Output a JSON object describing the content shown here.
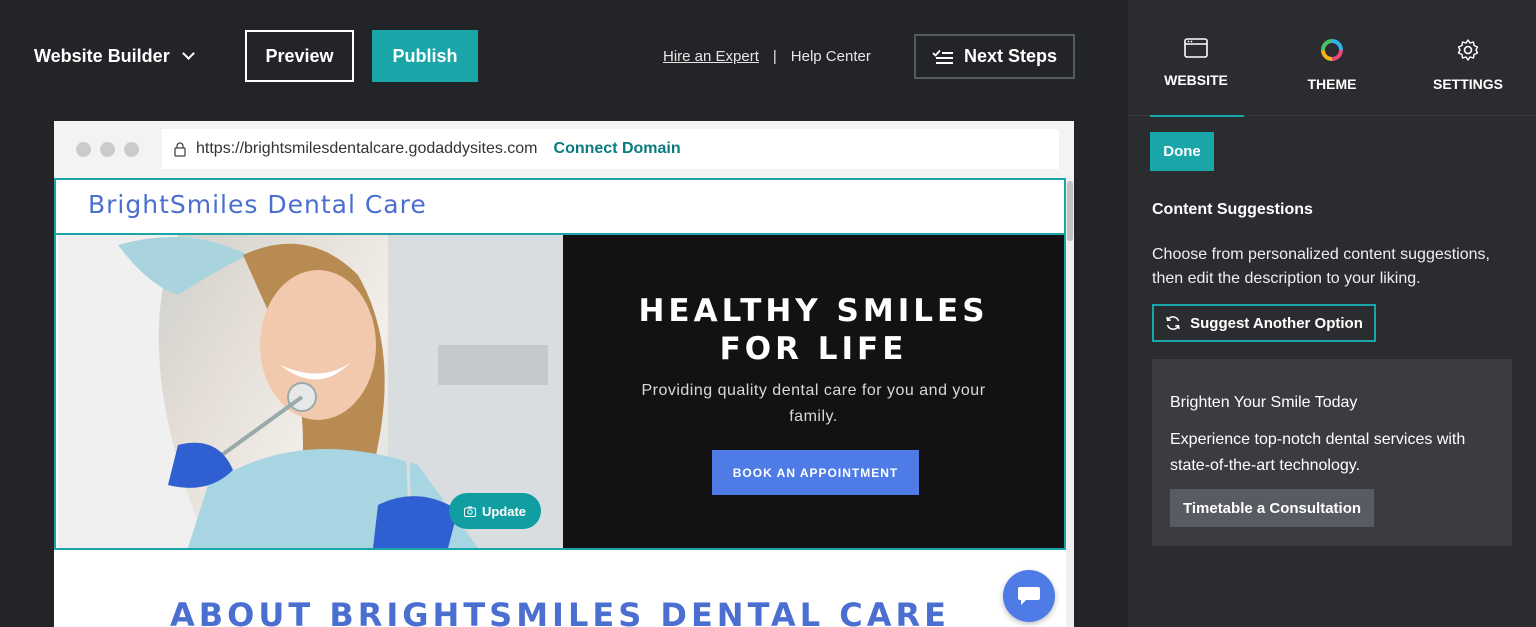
{
  "topbar": {
    "brand": "Website Builder",
    "preview_label": "Preview",
    "publish_label": "Publish",
    "hire_label": "Hire an Expert",
    "separator": "|",
    "help_label": "Help Center",
    "next_steps_label": "Next Steps"
  },
  "browser": {
    "url": "https://brightsmilesdentalcare.godaddysites.com",
    "connect_label": "Connect Domain"
  },
  "site": {
    "title": "BrightSmiles Dental Care",
    "hero_heading_line1": "HEALTHY SMILES",
    "hero_heading_line2": "FOR LIFE",
    "hero_text": "Providing quality dental care for you and your family.",
    "book_label": "BOOK AN APPOINTMENT",
    "update_label": "Update",
    "about_heading": "ABOUT BRIGHTSMILES DENTAL CARE"
  },
  "panel": {
    "tabs": [
      {
        "label": "WEBSITE",
        "icon": "browser-window-icon"
      },
      {
        "label": "THEME",
        "icon": "color-wheel-icon"
      },
      {
        "label": "SETTINGS",
        "icon": "gear-icon"
      }
    ],
    "done_label": "Done",
    "section_title": "Content Suggestions",
    "section_desc": "Choose from personalized content suggestions, then edit the description to your liking.",
    "suggest_label": "Suggest Another Option",
    "card": {
      "heading": "Brighten Your Smile Today",
      "text": "Experience top-notch dental services with state-of-the-art technology.",
      "button_label": "Timetable a Consultation"
    }
  },
  "colors": {
    "accent": "#1aa5a9",
    "brand_blue": "#4e7be6",
    "panel_bg": "#2b2c30",
    "app_bg": "#232427"
  }
}
